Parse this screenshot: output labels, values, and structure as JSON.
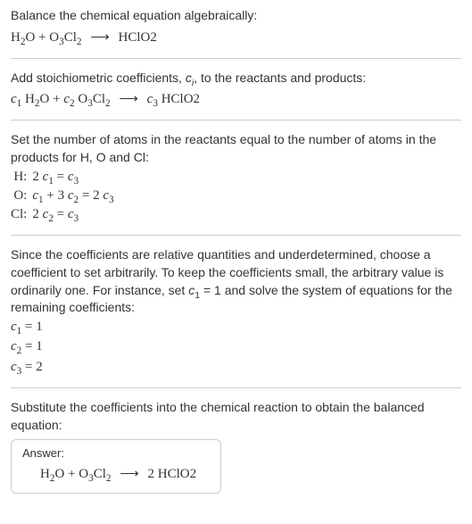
{
  "section1": {
    "prompt": "Balance the chemical equation algebraically:",
    "lhs1": "H",
    "lhs1_sub": "2",
    "lhs2": "O + O",
    "lhs2_sub": "3",
    "lhs3": "Cl",
    "lhs3_sub": "2",
    "arrow": "⟶",
    "rhs": "HClO2"
  },
  "section2": {
    "text1": "Add stoichiometric coefficients, ",
    "ci_c": "c",
    "ci_i": "i",
    "text2": ", to the reactants and products:",
    "c1": "c",
    "c1sub": "1",
    "sp1": " H",
    "sp1sub": "2",
    "sp2": "O + ",
    "c2": "c",
    "c2sub": "2",
    "sp3": " O",
    "sp3sub": "3",
    "sp4": "Cl",
    "sp4sub": "2",
    "arrow": "⟶",
    "c3": "c",
    "c3sub": "3",
    "rhs": " HClO2"
  },
  "section3": {
    "text": "Set the number of atoms in the reactants equal to the number of atoms in the products for H, O and Cl:",
    "rows": [
      {
        "el": "H:",
        "lhs_coef": "2 ",
        "lhs_c": "c",
        "lhs_sub": "1",
        "eq": " = ",
        "rhs_c": "c",
        "rhs_sub": "3",
        "extra": ""
      },
      {
        "el": "O:",
        "lhs_coef": "",
        "lhs_c": "c",
        "lhs_sub": "1",
        "mid": " + 3 ",
        "mid_c": "c",
        "mid_sub": "2",
        "eq": " = 2 ",
        "rhs_c": "c",
        "rhs_sub": "3"
      },
      {
        "el": "Cl:",
        "lhs_coef": "2 ",
        "lhs_c": "c",
        "lhs_sub": "2",
        "eq": " = ",
        "rhs_c": "c",
        "rhs_sub": "3",
        "extra": ""
      }
    ]
  },
  "section4": {
    "text1": "Since the coefficients are relative quantities and underdetermined, choose a coefficient to set arbitrarily. To keep the coefficients small, the arbitrary value is ordinarily one. For instance, set ",
    "cvar": "c",
    "csub": "1",
    "text2": " = 1 and solve the system of equations for the remaining coefficients:",
    "r1_c": "c",
    "r1_s": "1",
    "r1_v": " = 1",
    "r2_c": "c",
    "r2_s": "2",
    "r2_v": " = 1",
    "r3_c": "c",
    "r3_s": "3",
    "r3_v": " = 2"
  },
  "section5": {
    "text": "Substitute the coefficients into the chemical reaction to obtain the balanced equation:",
    "answerLabel": "Answer:",
    "eq_l1": "H",
    "eq_l1s": "2",
    "eq_l2": "O + O",
    "eq_l2s": "3",
    "eq_l3": "Cl",
    "eq_l3s": "2",
    "arrow": "⟶",
    "eq_r": " 2 HClO2"
  }
}
